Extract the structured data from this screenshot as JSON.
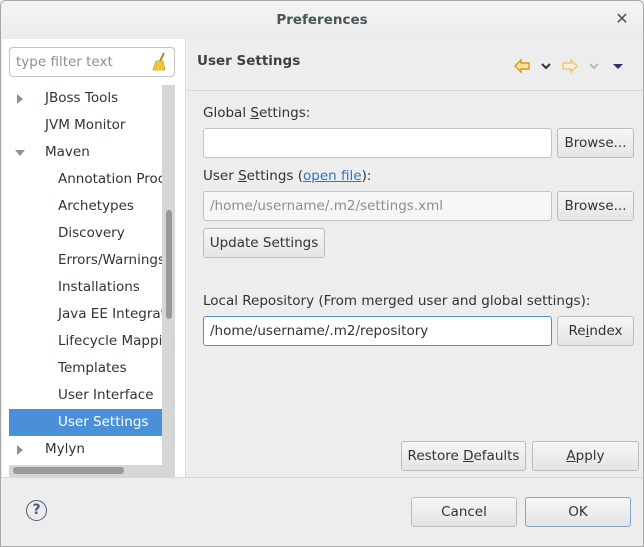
{
  "window": {
    "title": "Preferences",
    "close_icon": "close-icon"
  },
  "sidebar": {
    "filter_placeholder": "type filter text",
    "clear_icon": "broom-icon",
    "items": [
      {
        "label": "JBoss Tools",
        "level": 0,
        "expander": "collapsed"
      },
      {
        "label": "JVM Monitor",
        "level": 0,
        "expander": "none"
      },
      {
        "label": "Maven",
        "level": 0,
        "expander": "expanded"
      },
      {
        "label": "Annotation Processing",
        "level": 1,
        "expander": "none"
      },
      {
        "label": "Archetypes",
        "level": 1,
        "expander": "none"
      },
      {
        "label": "Discovery",
        "level": 1,
        "expander": "none"
      },
      {
        "label": "Errors/Warnings",
        "level": 1,
        "expander": "none"
      },
      {
        "label": "Installations",
        "level": 1,
        "expander": "none"
      },
      {
        "label": "Java EE Integration",
        "level": 1,
        "expander": "none"
      },
      {
        "label": "Lifecycle Mappings",
        "level": 1,
        "expander": "none"
      },
      {
        "label": "Templates",
        "level": 1,
        "expander": "none"
      },
      {
        "label": "User Interface",
        "level": 1,
        "expander": "none"
      },
      {
        "label": "User Settings",
        "level": 1,
        "expander": "none",
        "selected": true
      },
      {
        "label": "Mylyn",
        "level": 0,
        "expander": "collapsed"
      }
    ]
  },
  "page": {
    "title": "User Settings",
    "nav_icons": [
      "back-arrow-icon",
      "back-menu-chevron-icon",
      "forward-arrow-icon",
      "forward-menu-chevron-icon",
      "view-menu-icon"
    ],
    "global_settings": {
      "label_pre": "Global ",
      "label_mnemonic": "S",
      "label_post": "ettings:",
      "value": "",
      "browse_label": "Browse..."
    },
    "user_settings": {
      "label_pre": "User ",
      "label_mnemonic": "S",
      "label_post": "ettings (",
      "link": "open file",
      "label_end": "):",
      "value": "/home/username/.m2/settings.xml",
      "browse_label": "Browse..."
    },
    "update_settings_label": "Update Settings",
    "local_repo": {
      "label": "Local Repository (From merged user and global settings):",
      "value": "/home/username/.m2/repository",
      "reindex_pre": "Re",
      "reindex_mnemonic": "i",
      "reindex_post": "ndex"
    },
    "restore_defaults": {
      "pre": "Restore ",
      "mnemonic": "D",
      "post": "efaults"
    },
    "apply": {
      "mnemonic": "A",
      "post": "pply"
    }
  },
  "footer": {
    "help_icon": "help-icon",
    "help_glyph": "?",
    "cancel_label": "Cancel",
    "ok_label": "OK"
  },
  "colors": {
    "selection": "#4a90d9",
    "link": "#2a76c6",
    "nav_arrow": "#e1a21a"
  }
}
